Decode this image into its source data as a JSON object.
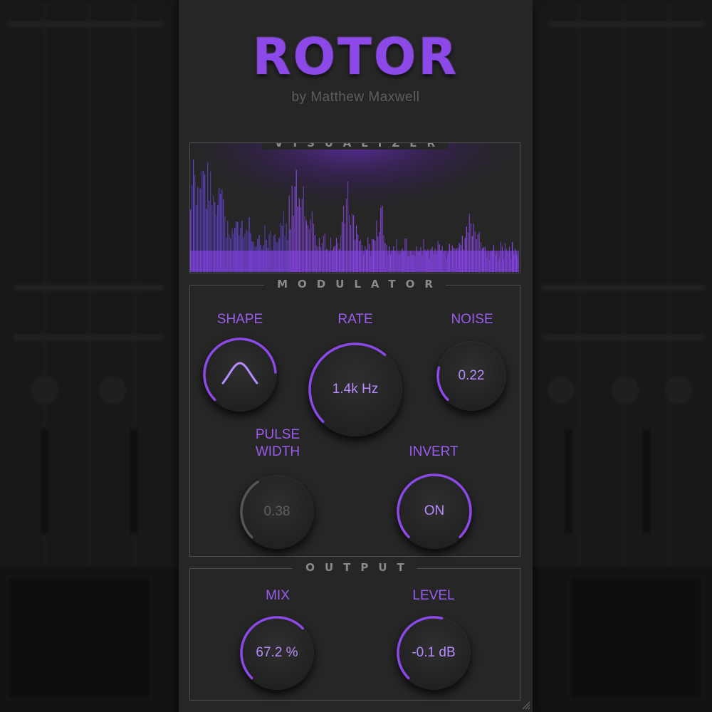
{
  "plugin": {
    "title": "ROTOR",
    "subtitle": "by Matthew Maxwell"
  },
  "visualizer": {
    "title": "VISUALIZER",
    "accent_color": "#8a44f0"
  },
  "modulator": {
    "title": "MODULATOR",
    "shape": {
      "label": "SHAPE",
      "icon": "sine-arch-icon",
      "level": 0.82
    },
    "rate": {
      "label": "RATE",
      "value": "1.4k Hz",
      "level": 0.65
    },
    "noise": {
      "label": "NOISE",
      "value": "0.22",
      "level": 0.22
    },
    "pulse_width": {
      "label_line1": "PULSE",
      "label_line2": "WIDTH",
      "value": "0.38",
      "level": 0.38
    },
    "invert": {
      "label": "INVERT",
      "value": "ON",
      "level": 1.0
    }
  },
  "output": {
    "title": "OUTPUT",
    "mix": {
      "label": "MIX",
      "value": "67.2 %",
      "level": 0.672
    },
    "level": {
      "label": "LEVEL",
      "value": "-0.1 dB",
      "level": 0.55
    }
  },
  "colors": {
    "accent": "#8d48e8",
    "accent_light": "#b68cff",
    "panel_bg": "#262626",
    "inactive_ring": "#555555"
  }
}
